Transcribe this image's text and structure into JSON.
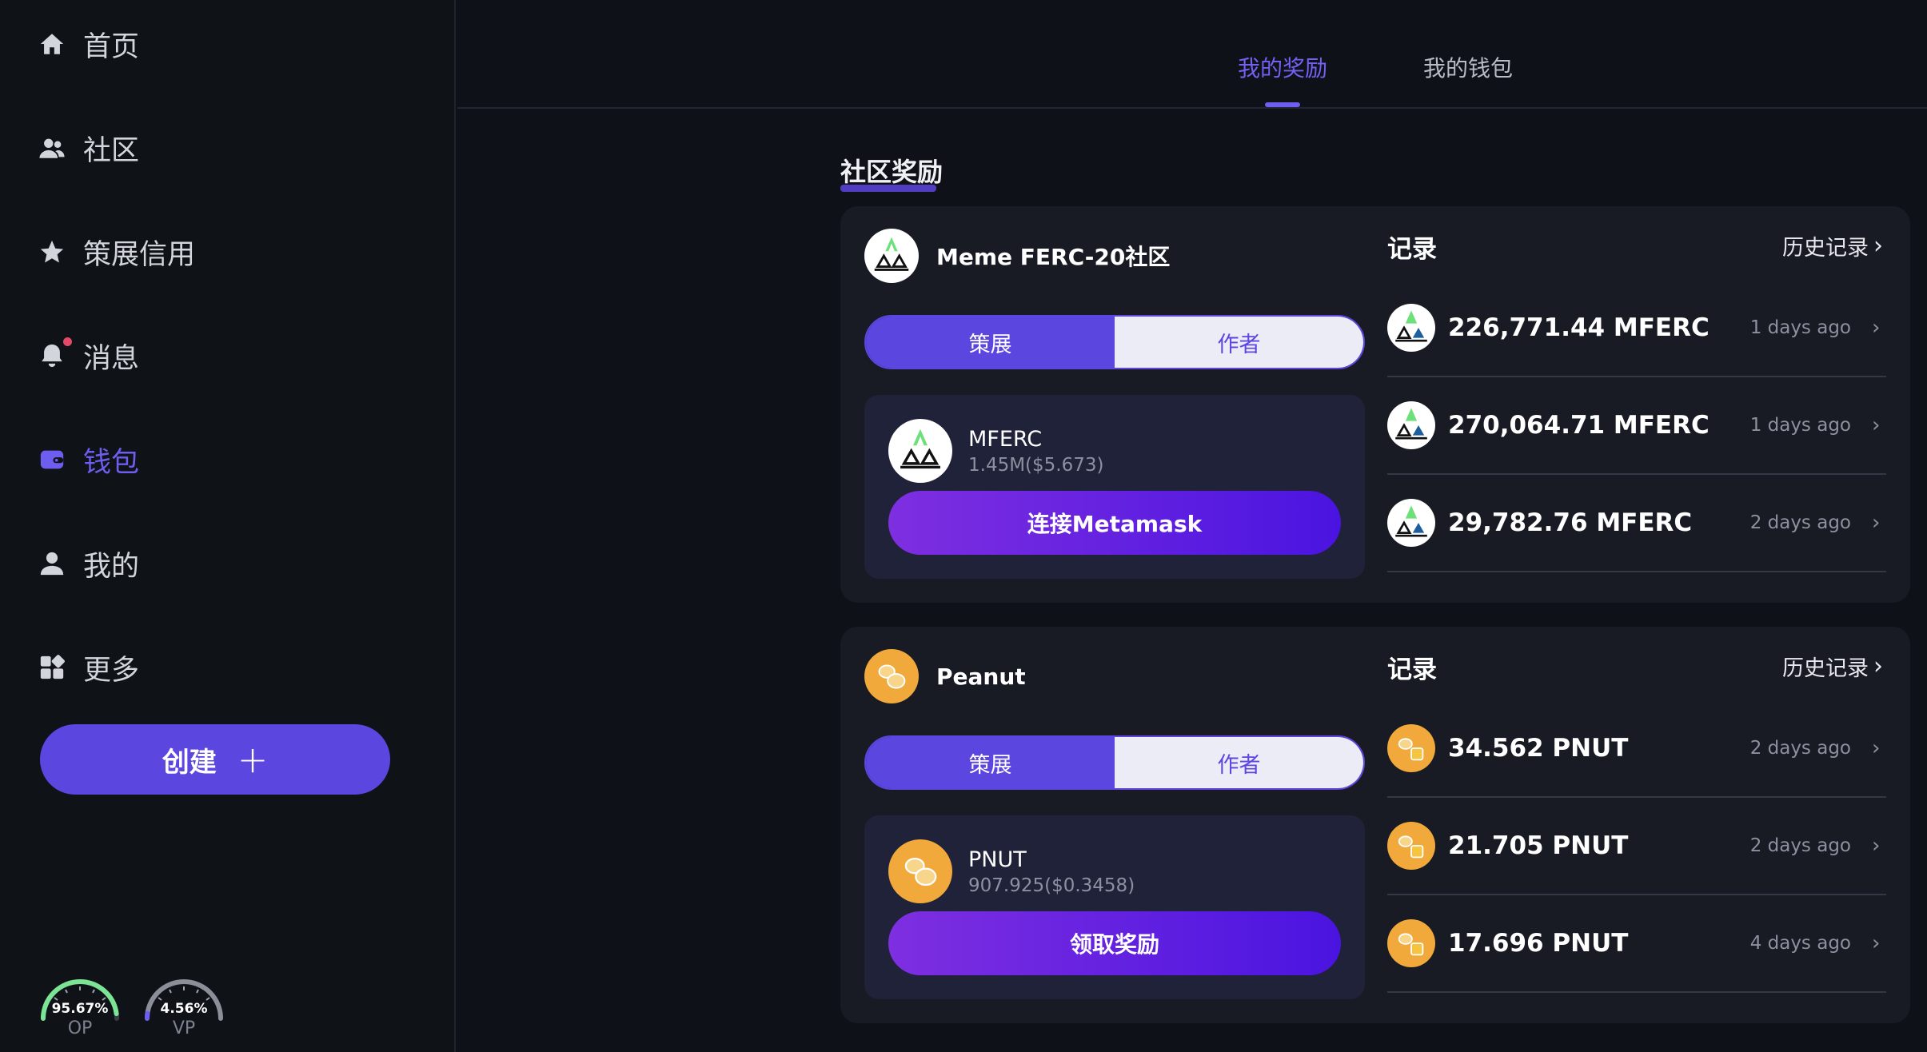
{
  "nav": {
    "items": [
      {
        "label": "首页",
        "icon": "home-icon"
      },
      {
        "label": "社区",
        "icon": "users-icon"
      },
      {
        "label": "策展信用",
        "icon": "star-icon"
      },
      {
        "label": "消息",
        "icon": "bell-icon"
      },
      {
        "label": "钱包",
        "icon": "wallet-icon"
      },
      {
        "label": "我的",
        "icon": "user-icon"
      },
      {
        "label": "更多",
        "icon": "grid-icon"
      }
    ],
    "create_label": "创建",
    "gauges": [
      {
        "value": "95.67%",
        "label": "OP",
        "level": 0.9567,
        "color": "#7be495"
      },
      {
        "value": "4.56%",
        "label": "VP",
        "level": 0.0456,
        "color": "#6e5ef0"
      }
    ]
  },
  "tabs": [
    {
      "label": "我的奖励"
    },
    {
      "label": "我的钱包"
    }
  ],
  "section_title": "社区奖励",
  "communities": [
    {
      "name": "Meme FERC-20社区",
      "segment": {
        "left": "策展",
        "right": "作者"
      },
      "token": {
        "name": "MFERC",
        "sub": "1.45M($5.673)"
      },
      "action_label": "连接Metamask",
      "records_title": "记录",
      "history_label": "历史记录",
      "records": [
        {
          "amount": "226,771.44 MFERC",
          "time": "1 days ago"
        },
        {
          "amount": "270,064.71 MFERC",
          "time": "1 days ago"
        },
        {
          "amount": "29,782.76 MFERC",
          "time": "2 days ago"
        }
      ]
    },
    {
      "name": "Peanut",
      "segment": {
        "left": "策展",
        "right": "作者"
      },
      "token": {
        "name": "PNUT",
        "sub": "907.925($0.3458)"
      },
      "action_label": "领取奖励",
      "records_title": "记录",
      "history_label": "历史记录",
      "records": [
        {
          "amount": "34.562 PNUT",
          "time": "2 days ago"
        },
        {
          "amount": "21.705 PNUT",
          "time": "2 days ago"
        },
        {
          "amount": "17.696 PNUT",
          "time": "4 days ago"
        }
      ]
    }
  ],
  "colors": {
    "accent": "#5b46e0",
    "active_nav": "#6e5ef0",
    "notification_dot": "#e34a67"
  }
}
